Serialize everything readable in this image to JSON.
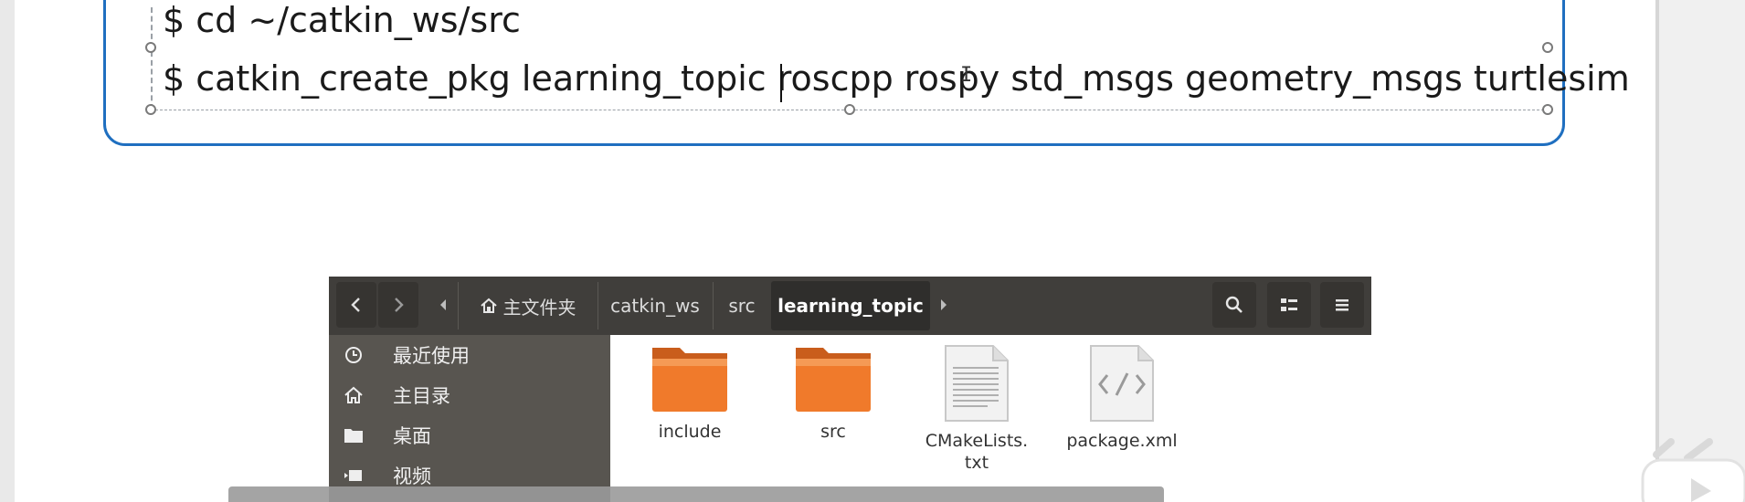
{
  "code": {
    "line1": "$ cd ~/catkin_ws/src",
    "line2": "$ catkin_create_pkg learning_topic roscpp rospy std_msgs geometry_msgs turtlesim"
  },
  "file_manager": {
    "breadcrumbs": [
      {
        "label": "主文件夹",
        "icon": "home-icon"
      },
      {
        "label": "catkin_ws"
      },
      {
        "label": "src"
      },
      {
        "label": "learning_topic",
        "active": true
      }
    ],
    "sidebar": [
      {
        "label": "最近使用",
        "icon": "clock-icon"
      },
      {
        "label": "主目录",
        "icon": "home-icon"
      },
      {
        "label": "桌面",
        "icon": "folder-icon"
      },
      {
        "label": "视频",
        "icon": "video-icon"
      }
    ],
    "files": [
      {
        "label": "include",
        "type": "folder"
      },
      {
        "label": "src",
        "type": "folder"
      },
      {
        "label": "CMakeLists.\ntxt",
        "type": "text-file"
      },
      {
        "label": "package.xml",
        "type": "xml-file"
      }
    ]
  }
}
